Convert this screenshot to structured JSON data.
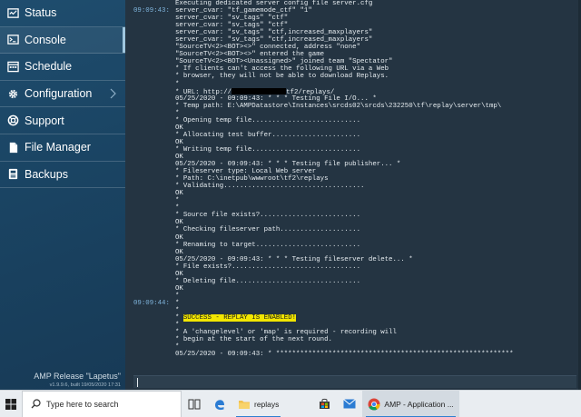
{
  "sidebar": {
    "items": [
      {
        "label": "Status",
        "icon": "status-icon"
      },
      {
        "label": "Console",
        "icon": "console-icon"
      },
      {
        "label": "Schedule",
        "icon": "schedule-icon"
      },
      {
        "label": "Configuration",
        "icon": "gear-icon"
      },
      {
        "label": "Support",
        "icon": "support-icon"
      },
      {
        "label": "File Manager",
        "icon": "file-icon"
      },
      {
        "label": "Backups",
        "icon": "backups-icon"
      }
    ],
    "release_title": "AMP Release \"Lapetus\"",
    "release_build": "v1.9.9.6, built 19/05/2020 17:31"
  },
  "console": {
    "lines": [
      {
        "ts": "",
        "text": "Executing dedicated server config file server.cfg"
      },
      {
        "ts": "09:09:43:",
        "text": "server_cvar: \"tf_gamemode_ctf\" \"1\""
      },
      {
        "ts": "",
        "text": "server_cvar: \"sv_tags\" \"ctf\""
      },
      {
        "ts": "",
        "text": "server_cvar: \"sv_tags\" \"ctf\""
      },
      {
        "ts": "",
        "text": "server_cvar: \"sv_tags\" \"ctf,increased_maxplayers\""
      },
      {
        "ts": "",
        "text": "server_cvar: \"sv_tags\" \"ctf,increased_maxplayers\""
      },
      {
        "ts": "",
        "text": "\"SourceTV<2><BOT><>\" connected, address \"none\""
      },
      {
        "ts": "",
        "text": "\"SourceTV<2><BOT><>\" entered the game"
      },
      {
        "ts": "",
        "text": "\"SourceTV<2><BOT><Unassigned>\" joined team \"Spectator\""
      },
      {
        "ts": "",
        "text": "* If clients can't access the following URL via a Web"
      },
      {
        "ts": "",
        "text": "* browser, they will not be able to download Replays."
      },
      {
        "ts": "",
        "text": "*"
      },
      {
        "ts": "",
        "text": "* URL: http://",
        "redact": true,
        "text_after": "tf2/replays/"
      },
      {
        "ts": "",
        "text": "05/25/2020 - 09:09:43: * * * Testing File I/O... *"
      },
      {
        "ts": "",
        "text": "* Temp path: E:\\AMPDatastore\\Instances\\srcds02\\srcds\\232250\\tf\\replay\\server\\tmp\\"
      },
      {
        "ts": "",
        "text": "*"
      },
      {
        "ts": "",
        "text": "* Opening temp file..........................."
      },
      {
        "ts": "",
        "text": "OK"
      },
      {
        "ts": "",
        "text": "* Allocating test buffer......................"
      },
      {
        "ts": "",
        "text": "OK"
      },
      {
        "ts": "",
        "text": "* Writing temp file..........................."
      },
      {
        "ts": "",
        "text": "OK"
      },
      {
        "ts": "",
        "text": "05/25/2020 - 09:09:43: * * * Testing file publisher... *"
      },
      {
        "ts": "",
        "text": "* Fileserver type: Local Web server"
      },
      {
        "ts": "",
        "text": "* Path: C:\\inetpub\\wwwroot\\tf2\\replays"
      },
      {
        "ts": "",
        "text": "* Validating..................................."
      },
      {
        "ts": "",
        "text": "OK"
      },
      {
        "ts": "",
        "text": "*"
      },
      {
        "ts": "",
        "text": "*"
      },
      {
        "ts": "",
        "text": "* Source file exists?........................."
      },
      {
        "ts": "",
        "text": "OK"
      },
      {
        "ts": "",
        "text": "* Checking fileserver path...................."
      },
      {
        "ts": "",
        "text": "OK"
      },
      {
        "ts": "",
        "text": "* Renaming to target.........................."
      },
      {
        "ts": "",
        "text": "OK"
      },
      {
        "ts": "",
        "text": "05/25/2020 - 09:09:43: * * * Testing fileserver delete... *"
      },
      {
        "ts": "",
        "text": "* File exists?................................"
      },
      {
        "ts": "",
        "text": "OK"
      },
      {
        "ts": "",
        "text": "* Deleting file..............................."
      },
      {
        "ts": "",
        "text": "OK"
      },
      {
        "ts": "",
        "text": "*"
      },
      {
        "ts": "09:09:44:",
        "text": "*"
      },
      {
        "ts": "",
        "text": "*"
      },
      {
        "ts": "",
        "text": "* ",
        "highlight": "SUCCESS - REPLAY IS ENABLED!"
      },
      {
        "ts": "",
        "text": "*"
      },
      {
        "ts": "",
        "text": "* A 'changelevel' or 'map' is required - recording will"
      },
      {
        "ts": "",
        "text": "* begin at the start of the next round."
      },
      {
        "ts": "",
        "text": "*"
      },
      {
        "ts": "",
        "text": "05/25/2020 - 09:09:43: * ***********************************************************"
      },
      {
        "ts": "",
        "text": ""
      }
    ]
  },
  "taskbar": {
    "search_placeholder": "Type here to search",
    "folder_label": "replays",
    "chrome_label": "AMP - Application ..."
  }
}
